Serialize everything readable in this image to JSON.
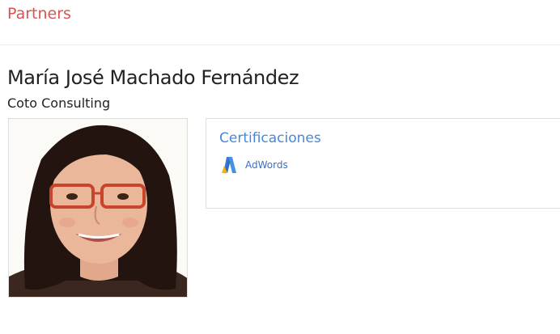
{
  "header": {
    "link_label": "Partners"
  },
  "profile": {
    "name": "María José Machado Fernández",
    "company": "Coto Consulting",
    "photo": {
      "icon": "profile-photo"
    }
  },
  "certifications": {
    "title": "Certificaciones",
    "items": [
      {
        "label": "AdWords",
        "icon": "adwords-logo-icon"
      }
    ]
  },
  "colors": {
    "accent_red": "#d9534f",
    "link_blue": "#4a86d8",
    "text_dark": "#222222",
    "border": "#dddddd"
  }
}
